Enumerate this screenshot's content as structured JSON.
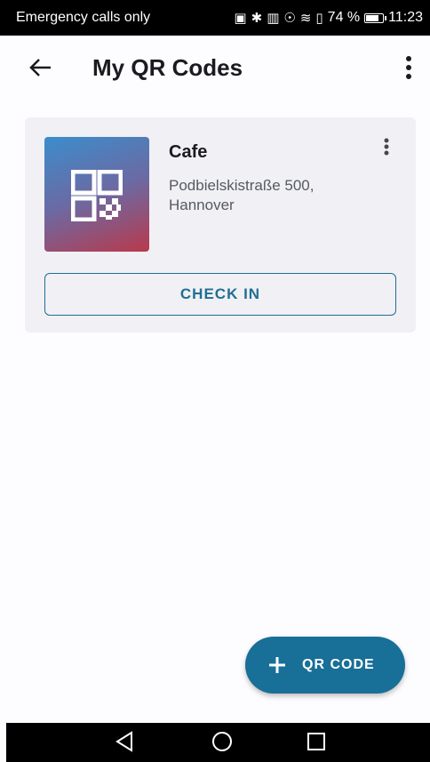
{
  "status_bar": {
    "carrier_text": "Emergency calls only",
    "icons": [
      "cast-icon",
      "bluetooth-icon",
      "nfc-icon",
      "eye-comfort-icon",
      "wifi-icon",
      "data-icon"
    ],
    "battery_percent_label": "74 %",
    "battery_level": 0.74,
    "time": "11:23"
  },
  "app_bar": {
    "title": "My QR Codes",
    "back_icon": "arrow-left-icon",
    "menu_icon": "more-vert-icon"
  },
  "cards": [
    {
      "title": "Cafe",
      "address_line1": "Podbielskistraße 500,",
      "address_line2": "Hannover",
      "thumbnail_icon": "qr-code-icon",
      "menu_icon": "more-vert-icon",
      "action_label": "CHECK IN"
    }
  ],
  "fab": {
    "label": "QR CODE",
    "icon": "plus-icon"
  },
  "nav_bar": {
    "icons": [
      "nav-back-icon",
      "nav-home-icon",
      "nav-recents-icon"
    ]
  },
  "colors": {
    "primary": "#186f98",
    "card_background": "#f1f0f4",
    "page_background": "#fdfcfe"
  }
}
